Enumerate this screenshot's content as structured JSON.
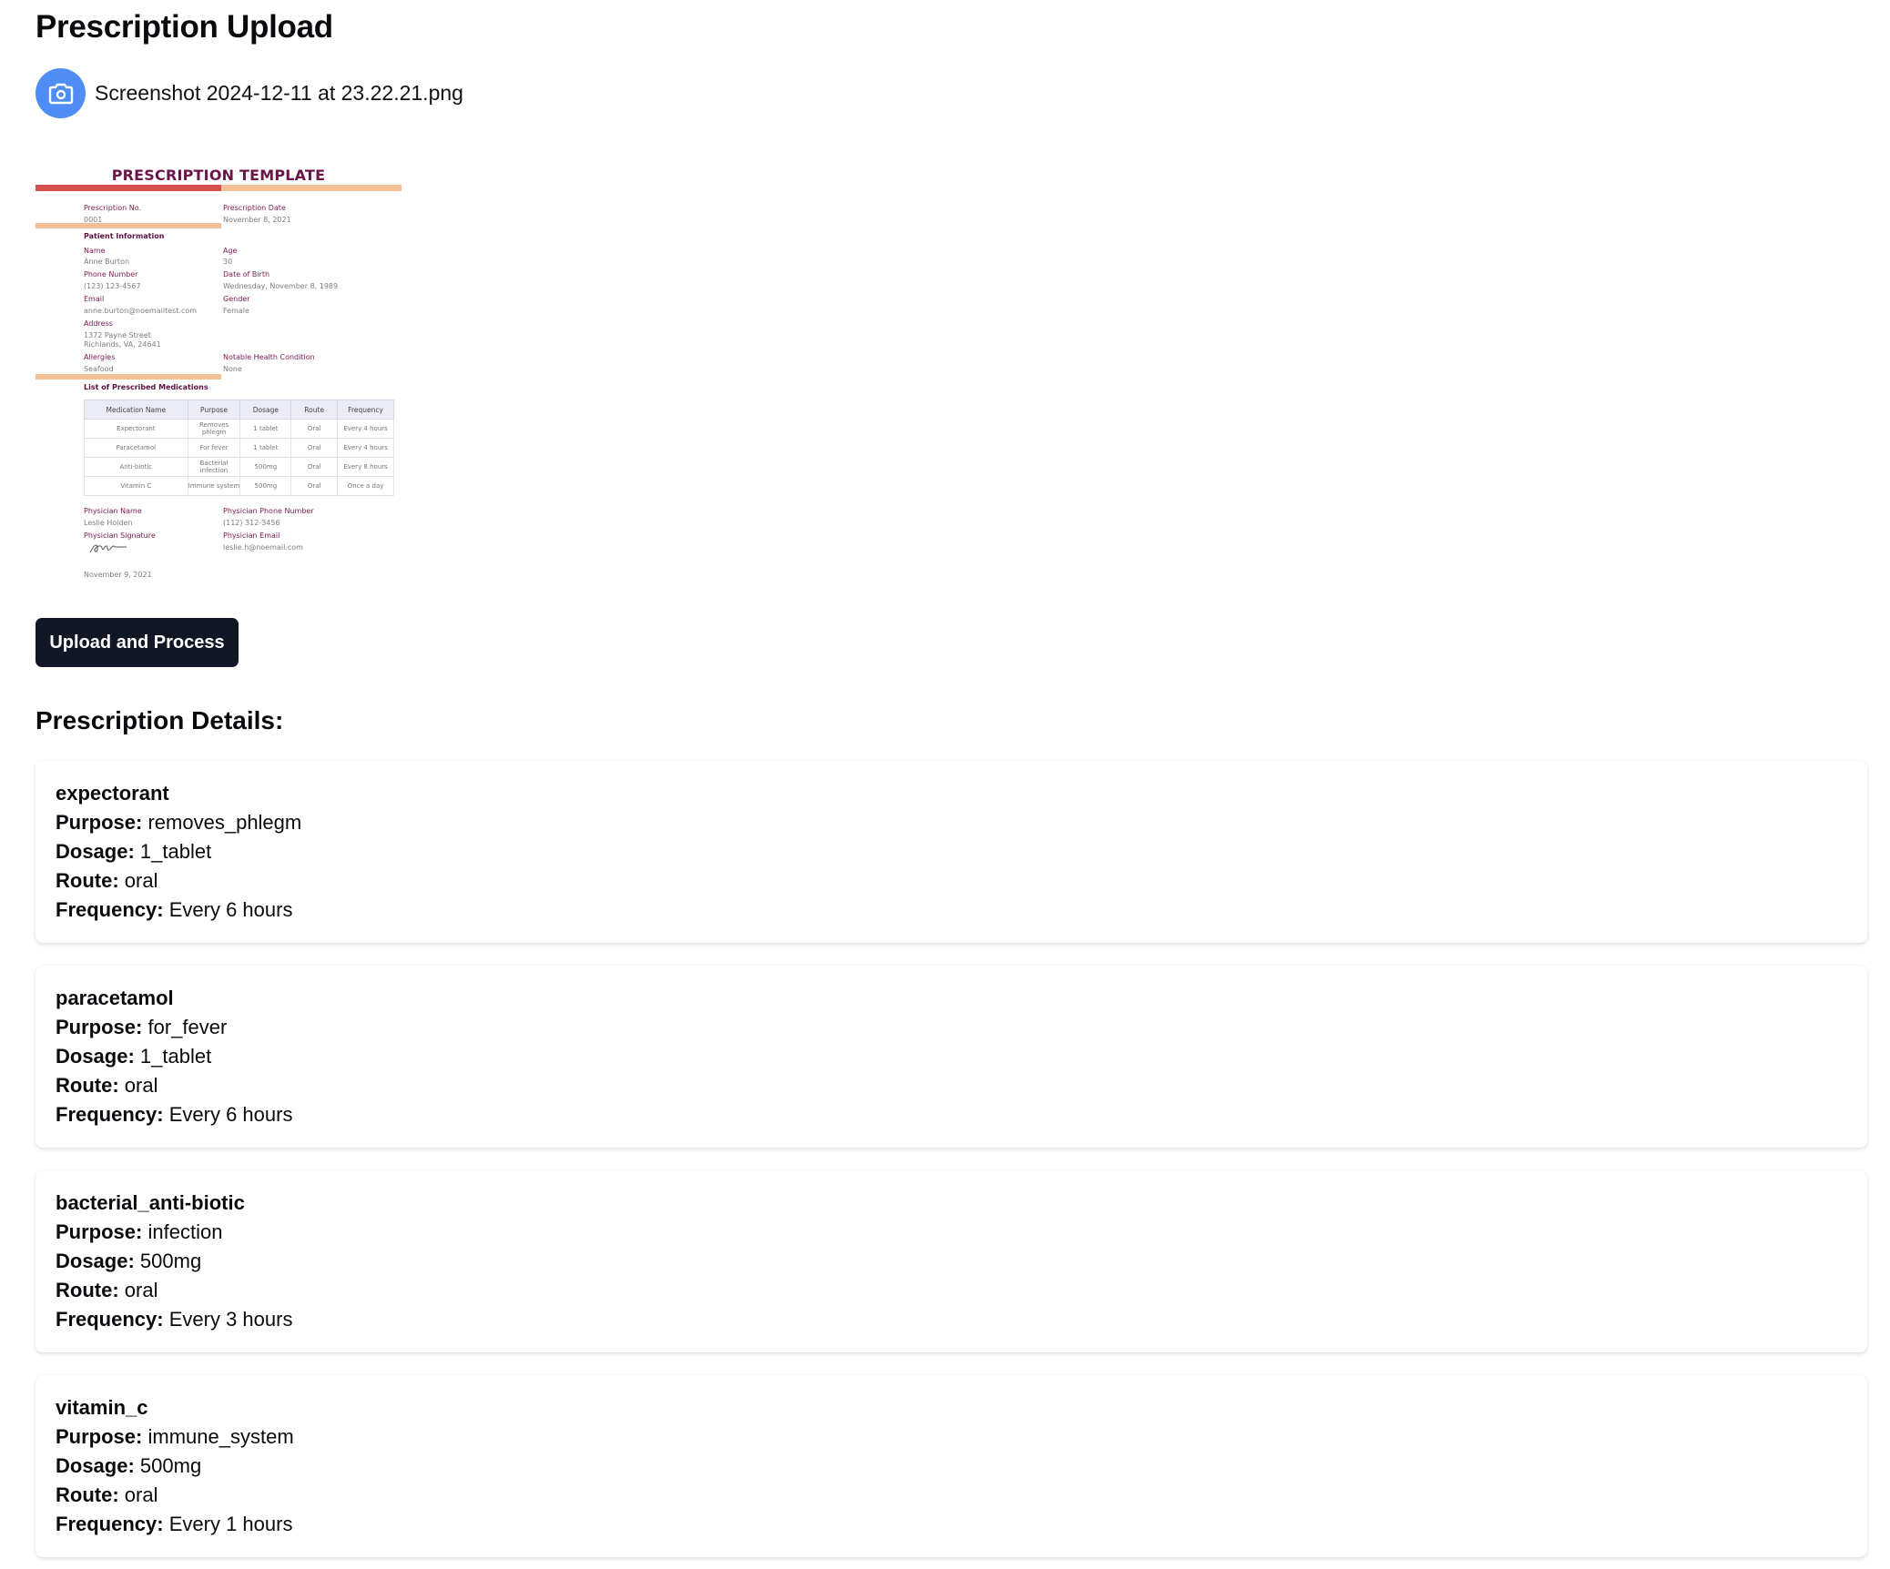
{
  "header": {
    "title": "Prescription Upload"
  },
  "file": {
    "name": "Screenshot 2024-12-11 at 23.22.21.png",
    "icon": "camera-icon"
  },
  "preview": {
    "title": "PRESCRIPTION TEMPLATE",
    "prescription_no_label": "Prescription No.",
    "prescription_no": "0001",
    "prescription_date_label": "Prescription Date",
    "prescription_date": "November 8, 2021",
    "patient_section": "Patient Information",
    "name_label": "Name",
    "name": "Anne Burton",
    "age_label": "Age",
    "age": "30",
    "phone_label": "Phone Number",
    "phone": "(123) 123-4567",
    "dob_label": "Date of Birth",
    "dob": "Wednesday, November 8, 1989",
    "email_label": "Email",
    "email": "anne.burton@noemailtest.com",
    "gender_label": "Gender",
    "gender": "Female",
    "address_label": "Address",
    "address_line1": "1372 Payne Street",
    "address_line2": "Richlands, VA, 24641",
    "allergies_label": "Allergies",
    "allergies": "Seafood",
    "health_label": "Notable Health Condition",
    "health": "None",
    "meds_section": "List of Prescribed Medications",
    "table": {
      "headers": [
        "Medication Name",
        "Purpose",
        "Dosage",
        "Route",
        "Frequency"
      ],
      "rows": [
        [
          "Expectorant",
          "Removes phlegm",
          "1 tablet",
          "Oral",
          "Every 4 hours"
        ],
        [
          "Paracetamol",
          "For fever",
          "1 tablet",
          "Oral",
          "Every 4 hours"
        ],
        [
          "Anti-biotic",
          "Bacterial infection",
          "500mg",
          "Oral",
          "Every 8 hours"
        ],
        [
          "Vitamin C",
          "Immune system",
          "500mg",
          "Oral",
          "Once a day"
        ]
      ]
    },
    "physician_name_label": "Physician Name",
    "physician_name": "Leslie Holden",
    "physician_phone_label": "Physician Phone Number",
    "physician_phone": "(112) 312-3456",
    "physician_sig_label": "Physician Signature",
    "physician_email_label": "Physician Email",
    "physician_email": "leslie.h@noemail.com",
    "sign_date": "November 9, 2021",
    "colors": {
      "title": "#6b1447",
      "bar_red": "#d4504f",
      "bar_peach": "#f3c094"
    }
  },
  "upload_button": {
    "label": "Upload and Process"
  },
  "details": {
    "heading": "Prescription Details:",
    "labels": {
      "purpose": "Purpose:",
      "dosage": "Dosage:",
      "route": "Route:",
      "frequency": "Frequency:"
    },
    "items": [
      {
        "name": "expectorant",
        "purpose": "removes_phlegm",
        "dosage": "1_tablet",
        "route": "oral",
        "frequency": "Every 6 hours"
      },
      {
        "name": "paracetamol",
        "purpose": "for_fever",
        "dosage": "1_tablet",
        "route": "oral",
        "frequency": "Every 6 hours"
      },
      {
        "name": "bacterial_anti-biotic",
        "purpose": "infection",
        "dosage": "500mg",
        "route": "oral",
        "frequency": "Every 3 hours"
      },
      {
        "name": "vitamin_c",
        "purpose": "immune_system",
        "dosage": "500mg",
        "route": "oral",
        "frequency": "Every 1 hours"
      }
    ]
  },
  "colors": {
    "camera_button": "#4f8cf3",
    "primary_button": "#121726"
  }
}
